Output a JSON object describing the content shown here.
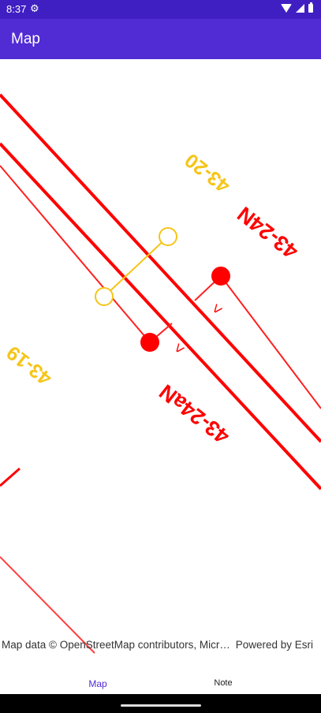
{
  "status_bar": {
    "time": "8:37",
    "icons": [
      "settings-gear-icon",
      "wifi-icon",
      "signal-icon",
      "battery-icon"
    ]
  },
  "app_bar": {
    "title": "Map",
    "color": "#512bd4"
  },
  "map": {
    "labels": {
      "top_red": "43-24N",
      "top_yellow": "43-20",
      "left_yellow": "43-19",
      "middle_red": "43-24aN",
      "chevron_upper": ">",
      "chevron_lower": ">"
    },
    "attribution": "Map data © OpenStreetMap contributors, Microsoft, Facebook, Inc. and its affiliates, Esri Community Maps contributors",
    "powered_by": "Powered by Esri",
    "colors": {
      "red_feature": "#ff0000",
      "yellow_feature": "#f5c518"
    }
  },
  "tabs": [
    {
      "label": "Map",
      "selected": true
    },
    {
      "label": "Note",
      "selected": false
    }
  ]
}
